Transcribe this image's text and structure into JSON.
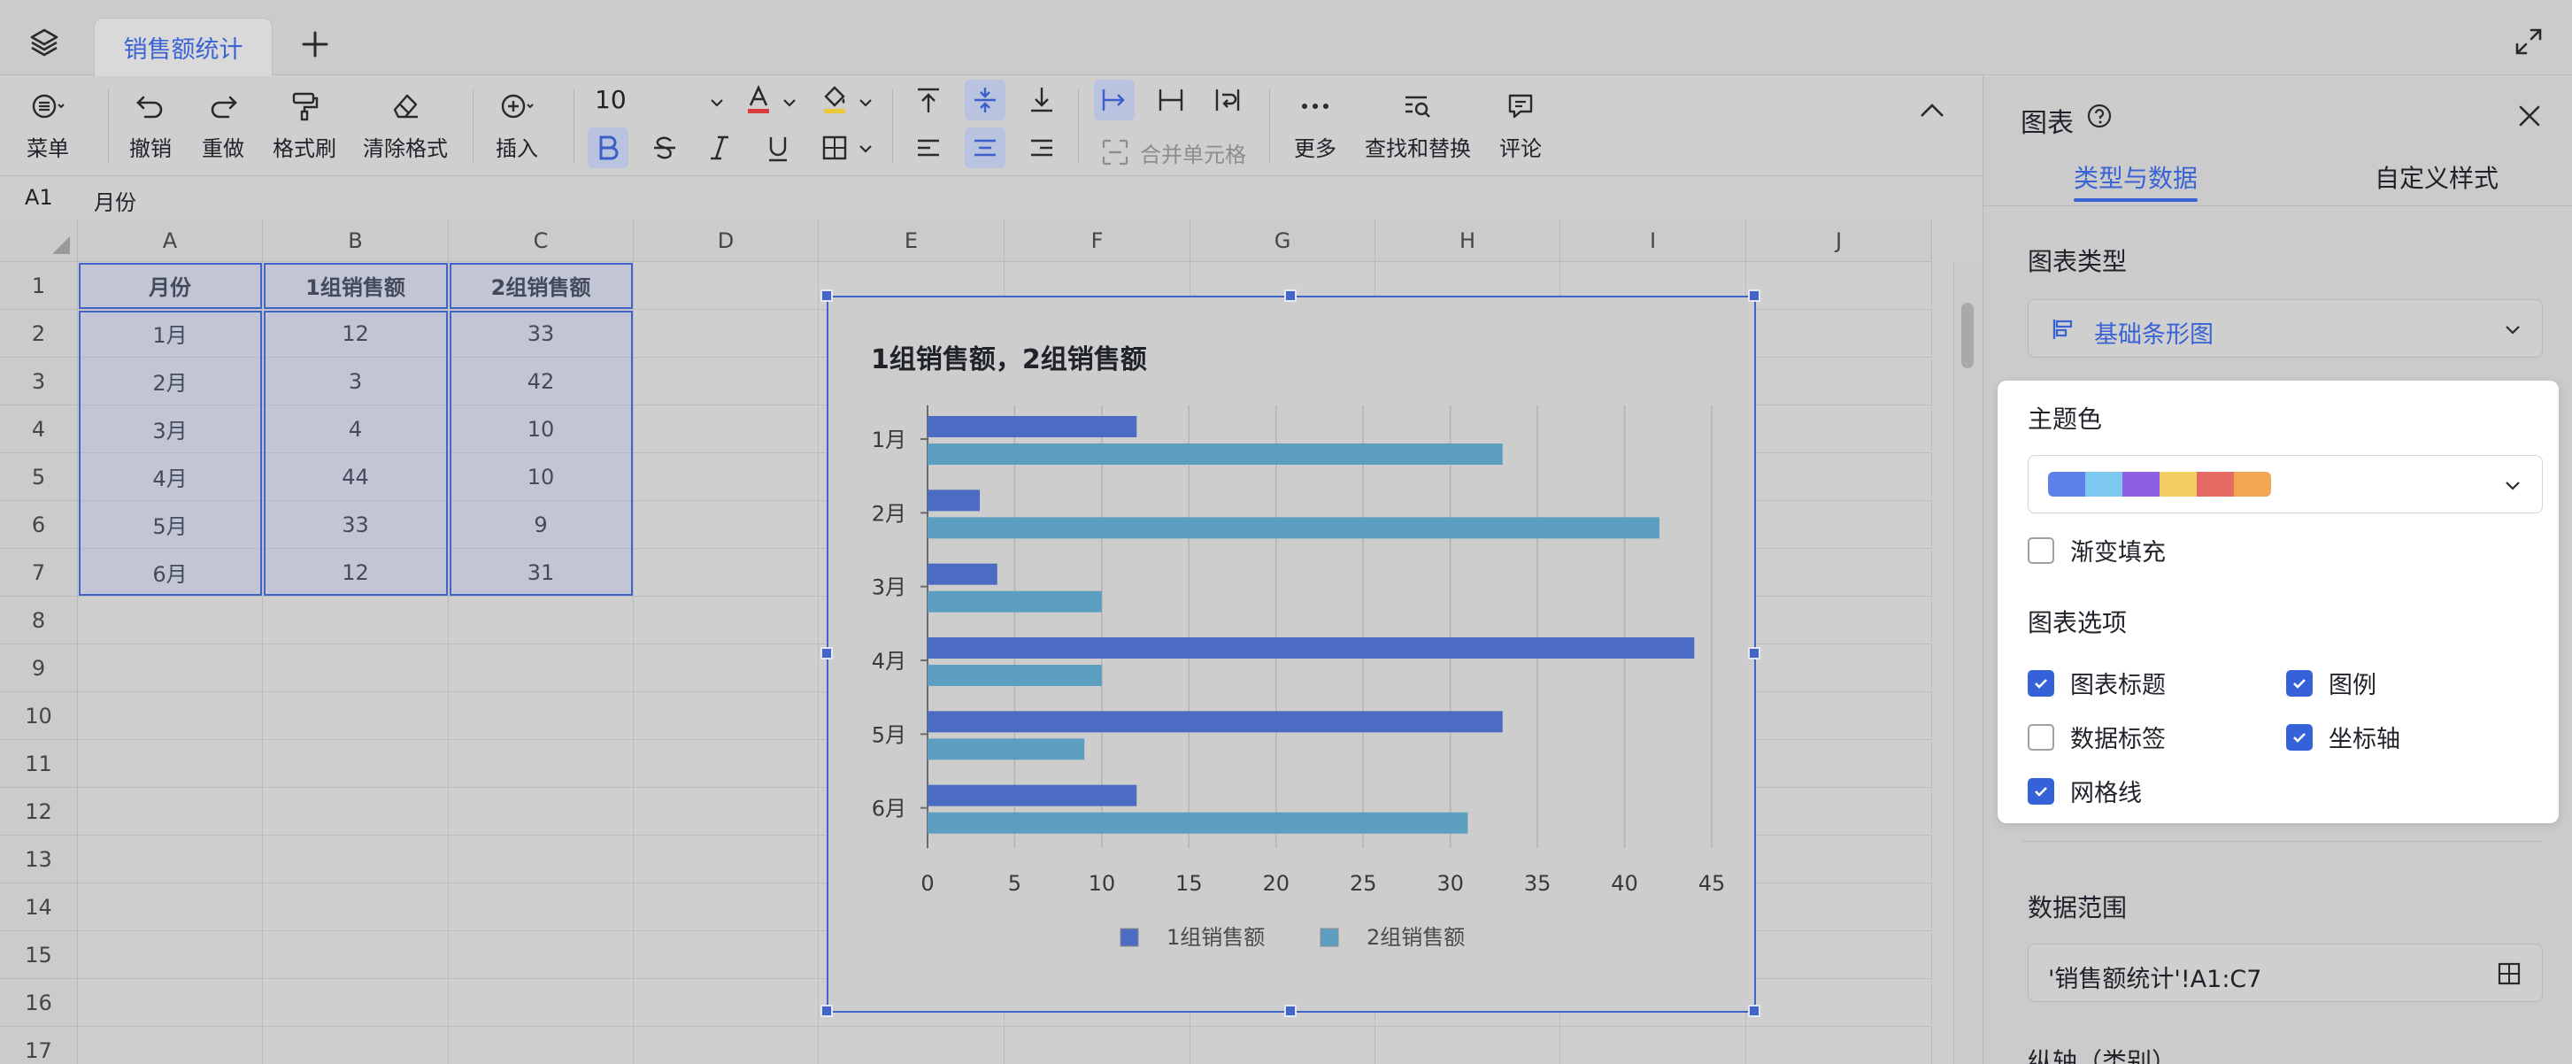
{
  "tabs": {
    "sheet_name": "销售额统计"
  },
  "toolbar": {
    "menu": "菜单",
    "undo": "撤销",
    "redo": "重做",
    "format_painter": "格式刷",
    "clear_format": "清除格式",
    "insert": "插入",
    "font_size": "10",
    "merge_cells": "合并单元格",
    "more": "更多",
    "find_replace": "查找和替换",
    "comment": "评论"
  },
  "formula_bar": {
    "cell_ref": "A1",
    "value": "月份"
  },
  "grid": {
    "columns": [
      "A",
      "B",
      "C",
      "D",
      "E",
      "F",
      "G",
      "H",
      "I",
      "J"
    ],
    "rows": [
      "1",
      "2",
      "3",
      "4",
      "5",
      "6",
      "7",
      "8",
      "9",
      "10",
      "11",
      "12",
      "13",
      "14",
      "15",
      "16",
      "17"
    ],
    "header": [
      "月份",
      "1组销售额",
      "2组销售额"
    ],
    "data": [
      [
        "1月",
        "12",
        "33"
      ],
      [
        "2月",
        "3",
        "42"
      ],
      [
        "3月",
        "4",
        "10"
      ],
      [
        "4月",
        "44",
        "10"
      ],
      [
        "5月",
        "33",
        "9"
      ],
      [
        "6月",
        "12",
        "31"
      ]
    ]
  },
  "chart_data": {
    "type": "bar",
    "orientation": "horizontal",
    "title": "1组销售额，2组销售额",
    "categories": [
      "1月",
      "2月",
      "3月",
      "4月",
      "5月",
      "6月"
    ],
    "series": [
      {
        "name": "1组销售额",
        "values": [
          12,
          3,
          4,
          44,
          33,
          12
        ],
        "color": "#4c6bc3"
      },
      {
        "name": "2组销售额",
        "values": [
          33,
          42,
          10,
          10,
          9,
          31
        ],
        "color": "#5d9fc1"
      }
    ],
    "xlim": [
      0,
      45
    ],
    "xticks": [
      "0",
      "5",
      "10",
      "15",
      "20",
      "25",
      "30",
      "35",
      "40",
      "45"
    ],
    "grid": true,
    "legend": "bottom"
  },
  "panel": {
    "title": "图表",
    "tab_type_data": "类型与数据",
    "tab_custom_style": "自定义样式",
    "chart_type_label": "图表类型",
    "chart_type_value": "基础条形图",
    "theme_label": "主题色",
    "theme_colors": [
      "#5b82e8",
      "#7cc8f0",
      "#8f5fe3",
      "#f3cd62",
      "#e56a64",
      "#f0a653"
    ],
    "gradient_fill": "渐变填充",
    "chart_options_label": "图表选项",
    "options": {
      "chart_title": "图表标题",
      "legend": "图例",
      "data_labels": "数据标签",
      "axis": "坐标轴",
      "gridlines": "网格线"
    },
    "data_range_label": "数据范围",
    "data_range_value": "'销售额统计'!A1:C7",
    "vertical_axis_label": "纵轴（类别）"
  }
}
